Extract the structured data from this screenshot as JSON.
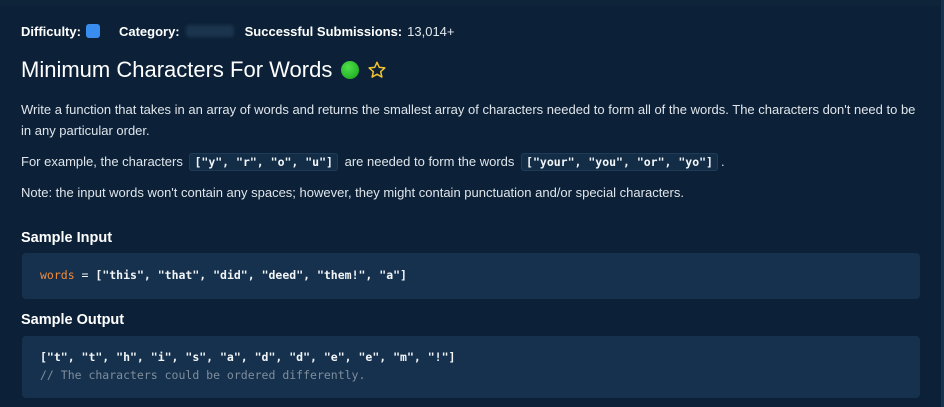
{
  "meta": {
    "difficulty_label": "Difficulty:",
    "difficulty_color": "#3a8df0",
    "category_label": "Category:",
    "submissions_label": "Successful Submissions:",
    "submissions_value": "13,014+"
  },
  "question": {
    "title": "Minimum Characters For Words",
    "status_color": "#2ec42b",
    "star_icon": "star-outline-icon",
    "description_1": "Write a function that takes in an array of words and returns the smallest array of characters needed to form all of the words. The characters don't need to be in any particular order.",
    "example_prefix": "For example, the characters",
    "example_chars_code": "[\"y\", \"r\", \"o\", \"u\"]",
    "example_middle": "are needed to form the words",
    "example_words_code": "[\"your\", \"you\", \"or\", \"yo\"]",
    "example_suffix": ".",
    "note": "Note: the input words won't contain any spaces; however, they might contain punctuation and/or special characters."
  },
  "sample_input": {
    "heading": "Sample Input",
    "var_name": "words",
    "assignment": " = ",
    "value": "[\"this\", \"that\", \"did\", \"deed\", \"them!\", \"a\"]"
  },
  "sample_output": {
    "heading": "Sample Output",
    "value": "[\"t\", \"t\", \"h\", \"i\", \"s\", \"a\", \"d\", \"d\", \"e\", \"e\", \"m\", \"!\"]",
    "comment": "// The characters could be ordered differently."
  }
}
